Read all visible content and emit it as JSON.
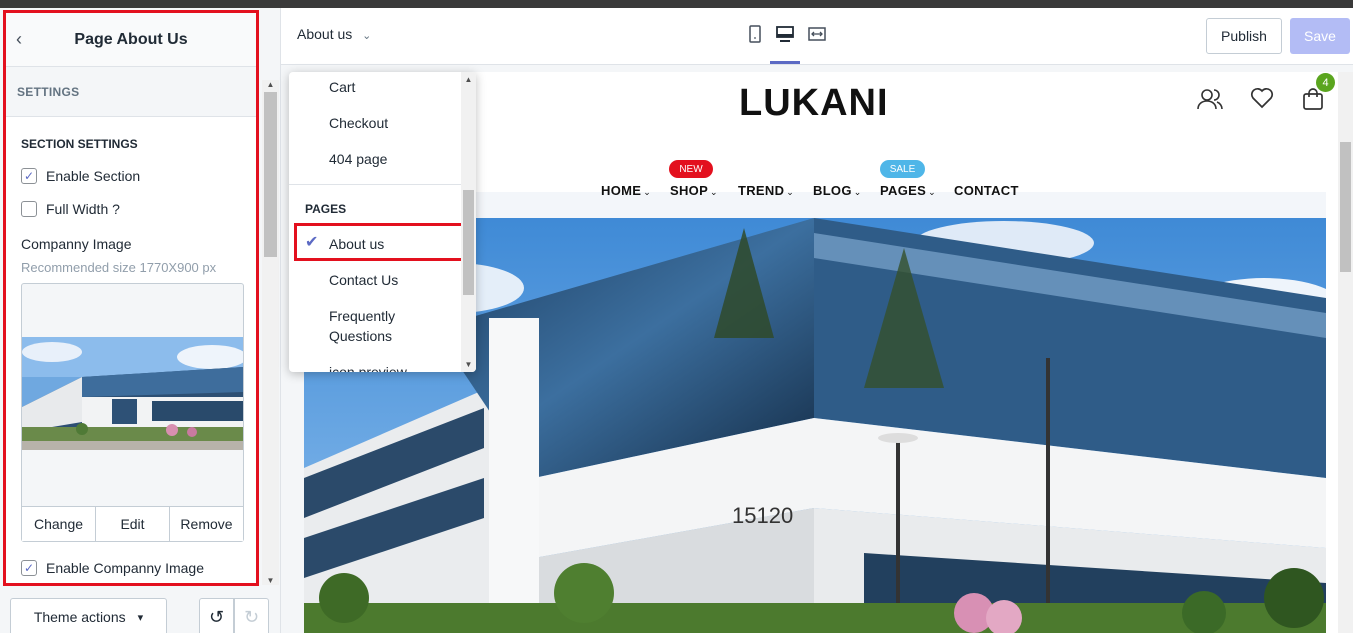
{
  "sidebar": {
    "title": "Page About Us",
    "settings_label": "SETTINGS",
    "section_settings_label": "SECTION SETTINGS",
    "enable_section_label": "Enable Section",
    "enable_section_checked": true,
    "full_width_label": "Full Width ?",
    "full_width_checked": false,
    "company_image_label": "Companny Image",
    "company_image_hint": "Recommended size 1770X900 px",
    "image_actions": [
      "Change",
      "Edit",
      "Remove"
    ],
    "enable_company_image_label": "Enable Companny Image",
    "enable_company_image_checked": true,
    "theme_actions_label": "Theme actions",
    "theme_actions_caret": "▾"
  },
  "topbar": {
    "page_selector": "About us",
    "publish_label": "Publish",
    "save_label": "Save",
    "devices": [
      "mobile-icon",
      "desktop-icon",
      "fullwidth-icon"
    ]
  },
  "dropdown": {
    "items_top": [
      "Cart",
      "Checkout",
      "404 page"
    ],
    "heading": "PAGES",
    "selected": "About us",
    "items_bottom": [
      "Contact Us",
      "Frequently Questions",
      "icon preview"
    ]
  },
  "store": {
    "logo": "LUKANI",
    "cart_count": "4",
    "nav": [
      "HOME",
      "SHOP",
      "TREND",
      "BLOG",
      "PAGES",
      "CONTACT"
    ],
    "badges": {
      "shop": "NEW",
      "pages": "SALE"
    },
    "badge_colors": {
      "new": "#e3101e",
      "sale": "#4fb6e8"
    },
    "building_number": "15120"
  },
  "colors": {
    "accent": "#5c6ac4",
    "highlight_box": "#e3101e",
    "save_disabled": "#b3bcf5"
  }
}
